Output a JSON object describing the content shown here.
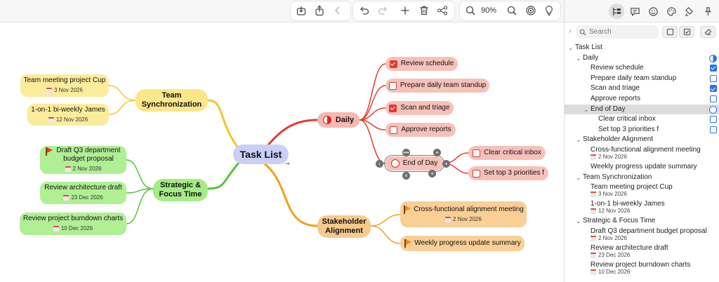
{
  "toolbar": {
    "zoom": "90%",
    "icons": [
      "export-icon",
      "share-icon",
      "back-icon",
      "undo-icon",
      "redo-icon",
      "add-icon",
      "trash-icon",
      "connect-icon",
      "zoom-out-icon",
      "zoom-in-icon",
      "focus-icon",
      "idea-icon"
    ]
  },
  "mindmap": {
    "central": "Task List",
    "branches": {
      "daily": {
        "label": "Daily",
        "color": "#e8392f",
        "tasks": [
          {
            "label": "Review schedule",
            "done": true
          },
          {
            "label": "Prepare daily team standup",
            "done": false
          },
          {
            "label": "Scan and triage",
            "done": true
          },
          {
            "label": "Approve reports",
            "done": false
          }
        ],
        "end_of_day": {
          "label": "End of Day",
          "tasks": [
            {
              "label": "Clear critical inbox",
              "done": false
            },
            {
              "label": "Set top 3 priorities f",
              "done": false
            }
          ]
        }
      },
      "stakeholder": {
        "label": "Stakeholder Alignment",
        "color": "#f2a21b",
        "tasks": [
          {
            "label": "Cross-functional alignment meeting",
            "date": "2 Nov 2026"
          },
          {
            "label": "Weekly progress update summary",
            "date": ""
          }
        ]
      },
      "team_sync": {
        "label": "Team Synchronization",
        "color": "#f4c531",
        "tasks": [
          {
            "label": "Team meeting project Cup",
            "date": "3 Nov 2026"
          },
          {
            "label": "1-on-1 bi-weekly James",
            "date": "12 Nov 2026"
          }
        ]
      },
      "strategic": {
        "label": "Strategic & Focus Time",
        "color": "#52c63a",
        "tasks": [
          {
            "label": "Draft Q3 department budget proposal",
            "date": "2 Nov 2026"
          },
          {
            "label": "Review architecture draft",
            "date": "23 Dec 2026"
          },
          {
            "label": "Review project burndown charts",
            "date": "10 Dec 2026"
          }
        ]
      }
    }
  },
  "panel": {
    "tabs": [
      "outline-icon",
      "comment-icon",
      "emoji-icon",
      "style-icon",
      "format-icon",
      "pin-icon"
    ],
    "search_placeholder": "Search",
    "outline": {
      "root": "Task List",
      "daily": "Daily",
      "review_schedule": "Review schedule",
      "prepare_standup": "Prepare daily team standup",
      "scan_triage": "Scan and triage",
      "approve_reports": "Approve reports",
      "end_of_day": "End of Day",
      "clear_inbox": "Clear critical inbox",
      "set_priorities": "Set top 3 priorities f",
      "stakeholder": "Stakeholder Alignment",
      "cross_functional": "Cross-functional alignment meeting",
      "cross_functional_date": "2 Nov 2026",
      "weekly_summary": "Weekly progress update summary",
      "team_sync": "Team Synchronization",
      "team_meeting": "Team meeting project Cup",
      "team_meeting_date": "3 Nov 2026",
      "one_on_one": "1-on-1 bi-weekly James",
      "one_on_one_date": "12 Nov 2026",
      "strategic": "Strategic & Focus Time",
      "draft_q3": "Draft Q3 department budget proposal",
      "draft_q3_date": "2 Nov 2026",
      "arch_draft": "Review architecture draft",
      "arch_draft_date": "23 Dec 2026",
      "burndown": "Review project burndown charts",
      "burndown_date": "10 Dec 2026"
    },
    "checks": {
      "review_schedule": true,
      "prepare_standup": false,
      "scan_triage": true,
      "approve_reports": false,
      "clear_inbox": false,
      "set_priorities": false
    }
  }
}
